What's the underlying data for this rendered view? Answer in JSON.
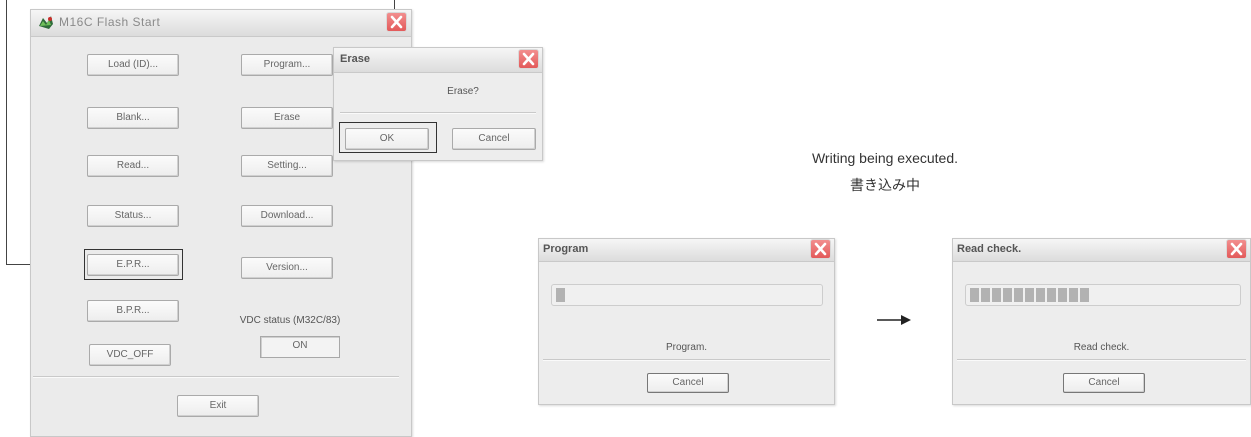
{
  "main_window": {
    "title": "M16C Flash Start",
    "buttons": {
      "load": "Load (ID)...",
      "program": "Program...",
      "blank": "Blank...",
      "erase": "Erase",
      "read": "Read...",
      "setting": "Setting...",
      "status": "Status...",
      "download": "Download...",
      "epr": "E.P.R...",
      "version": "Version...",
      "bpr": "B.P.R...",
      "vdc_off": "VDC_OFF",
      "exit": "Exit"
    },
    "vdc_status_label": "VDC status (M32C/83)",
    "vdc_status_value": "ON"
  },
  "erase_dialog": {
    "title": "Erase",
    "message": "Erase?",
    "ok": "OK",
    "cancel": "Cancel"
  },
  "caption": {
    "english": "Writing being executed.",
    "japanese": "書き込み中"
  },
  "program_dialog": {
    "title": "Program",
    "status": "Program.",
    "cancel": "Cancel",
    "progress_blocks": 1
  },
  "read_check_dialog": {
    "title": "Read check.",
    "status": "Read check.",
    "cancel": "Cancel",
    "progress_blocks": 11
  },
  "icons": [
    "app-icon",
    "close-icon",
    "arrow-right-icon"
  ],
  "colors": {
    "close_button": "#e35a5a",
    "highlight_border": "#333333"
  }
}
